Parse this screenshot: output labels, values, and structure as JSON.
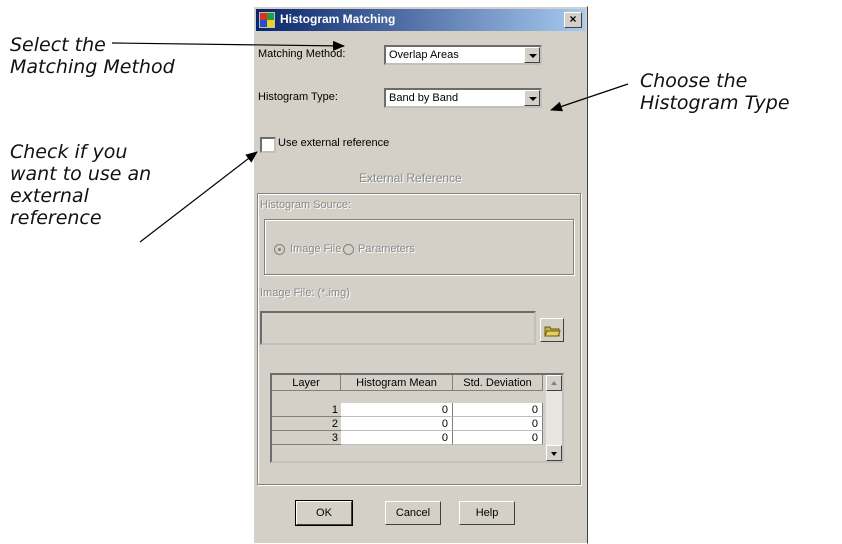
{
  "annotations": {
    "matching_method": [
      "Select the",
      "Matching Method"
    ],
    "histogram_type": [
      "Choose the",
      "Histogram Type"
    ],
    "external_reference": [
      "Check if you",
      "want to use an",
      "external",
      "reference"
    ]
  },
  "dialog": {
    "title": "Histogram Matching",
    "close_glyph": "×",
    "matching_method_label": "Matching Method:",
    "matching_method_value": "Overlap Areas",
    "histogram_type_label": "Histogram Type:",
    "histogram_type_value": "Band by Band",
    "use_external_label": "Use external reference",
    "use_external_checked": false,
    "external_reference_title": "External Reference",
    "histogram_source_label": "Histogram Source:",
    "radio_image_file": "Image File",
    "radio_parameters": "Parameters",
    "image_file_label": "Image File: (*.img)",
    "image_file_value": "",
    "table": {
      "columns": [
        "Layer",
        "Histogram Mean",
        "Std. Deviation"
      ],
      "rows": [
        {
          "layer": "1",
          "mean": "0",
          "std": "0"
        },
        {
          "layer": "2",
          "mean": "0",
          "std": "0"
        },
        {
          "layer": "3",
          "mean": "0",
          "std": "0"
        }
      ]
    },
    "buttons": {
      "ok": "OK",
      "cancel": "Cancel",
      "help": "Help"
    }
  },
  "icons": [
    "app-icon",
    "close-icon",
    "dropdown-arrow-icon",
    "folder-open-icon",
    "scroll-up-icon",
    "scroll-down-icon"
  ]
}
